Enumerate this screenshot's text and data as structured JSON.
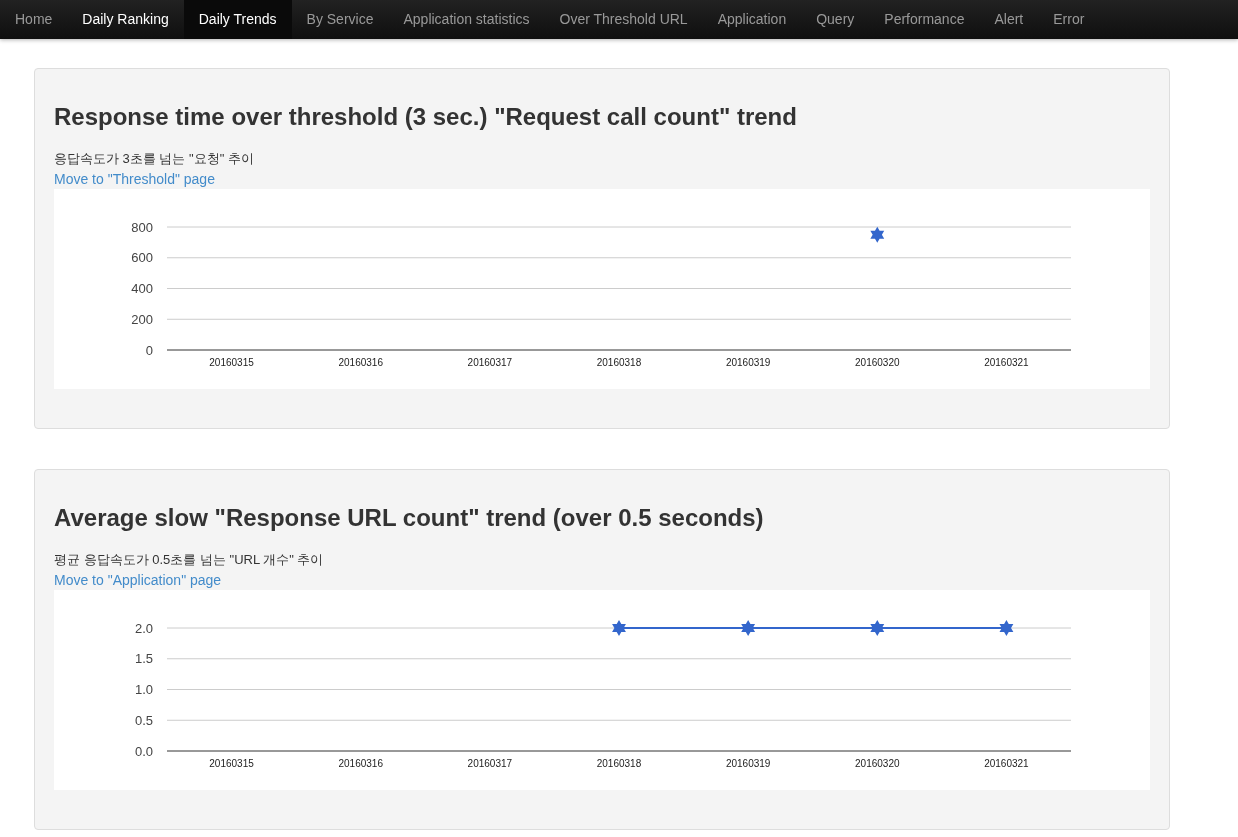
{
  "nav": [
    {
      "label": "Home",
      "selected": false,
      "highlighted": false
    },
    {
      "label": "Daily Ranking",
      "selected": false,
      "highlighted": true
    },
    {
      "label": "Daily Trends",
      "selected": true,
      "highlighted": true
    },
    {
      "label": "By Service",
      "selected": false,
      "highlighted": false
    },
    {
      "label": "Application statistics",
      "selected": false,
      "highlighted": false
    },
    {
      "label": "Over Threshold URL",
      "selected": false,
      "highlighted": false
    },
    {
      "label": "Application",
      "selected": false,
      "highlighted": false
    },
    {
      "label": "Query",
      "selected": false,
      "highlighted": false
    },
    {
      "label": "Performance",
      "selected": false,
      "highlighted": false
    },
    {
      "label": "Alert",
      "selected": false,
      "highlighted": false
    },
    {
      "label": "Error",
      "selected": false,
      "highlighted": false
    }
  ],
  "panels": [
    {
      "title": "Response time over threshold (3 sec.) \"Request call count\" trend",
      "subtitle": "응답속도가 3초를 넘는 \"요청\" 추이",
      "link": "Move to \"Threshold\" page",
      "chart_data": {
        "type": "line",
        "categories": [
          "20160315",
          "20160316",
          "20160317",
          "20160318",
          "20160319",
          "20160320",
          "20160321"
        ],
        "ylim": [
          0,
          800
        ],
        "yticks": [
          0,
          200,
          400,
          600,
          800
        ],
        "grid": true,
        "series": [
          {
            "marker": "star",
            "color": "#3366cc",
            "values": [
              null,
              null,
              null,
              null,
              null,
              750,
              null
            ]
          }
        ]
      }
    },
    {
      "title": "Average slow \"Response URL count\" trend (over 0.5 seconds)",
      "subtitle": "평균 응답속도가 0.5초를 넘는 \"URL 개수\" 추이",
      "link": "Move to \"Application\" page",
      "chart_data": {
        "type": "line",
        "categories": [
          "20160315",
          "20160316",
          "20160317",
          "20160318",
          "20160319",
          "20160320",
          "20160321"
        ],
        "ylim": [
          0,
          2
        ],
        "yticks": [
          {
            "value": 0,
            "label": "0.0"
          },
          {
            "value": 0.5,
            "label": "0.5"
          },
          {
            "value": 1,
            "label": "1.0"
          },
          {
            "value": 1.5,
            "label": "1.5"
          },
          {
            "value": 2,
            "label": "2.0"
          }
        ],
        "grid": true,
        "series": [
          {
            "marker": "star",
            "color": "#3366cc",
            "values": [
              null,
              null,
              null,
              2,
              2,
              2,
              2
            ]
          }
        ]
      }
    }
  ]
}
